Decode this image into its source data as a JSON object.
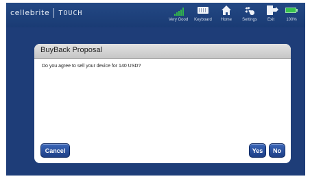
{
  "header": {
    "brand_primary": "cellebrite",
    "brand_secondary": "TOUCH",
    "toolbar": [
      {
        "label": "Very Good",
        "icon": "signal-icon"
      },
      {
        "label": "Keyboard",
        "icon": "keyboard-icon"
      },
      {
        "label": "Home",
        "icon": "home-icon"
      },
      {
        "label": "Settings",
        "icon": "settings-icon"
      },
      {
        "label": "Exit",
        "icon": "exit-icon"
      },
      {
        "label": "100%",
        "icon": "battery-icon"
      }
    ]
  },
  "dialog": {
    "title": "BuyBack Proposal",
    "message": "Do you agree to sell your device for 140 USD?",
    "cancel_label": "Cancel",
    "yes_label": "Yes",
    "no_label": "No"
  },
  "colors": {
    "background": "#1e3d78",
    "button": "#2a56a8",
    "header_gray": "#d0d0d0",
    "signal_green": "#33b84a"
  }
}
